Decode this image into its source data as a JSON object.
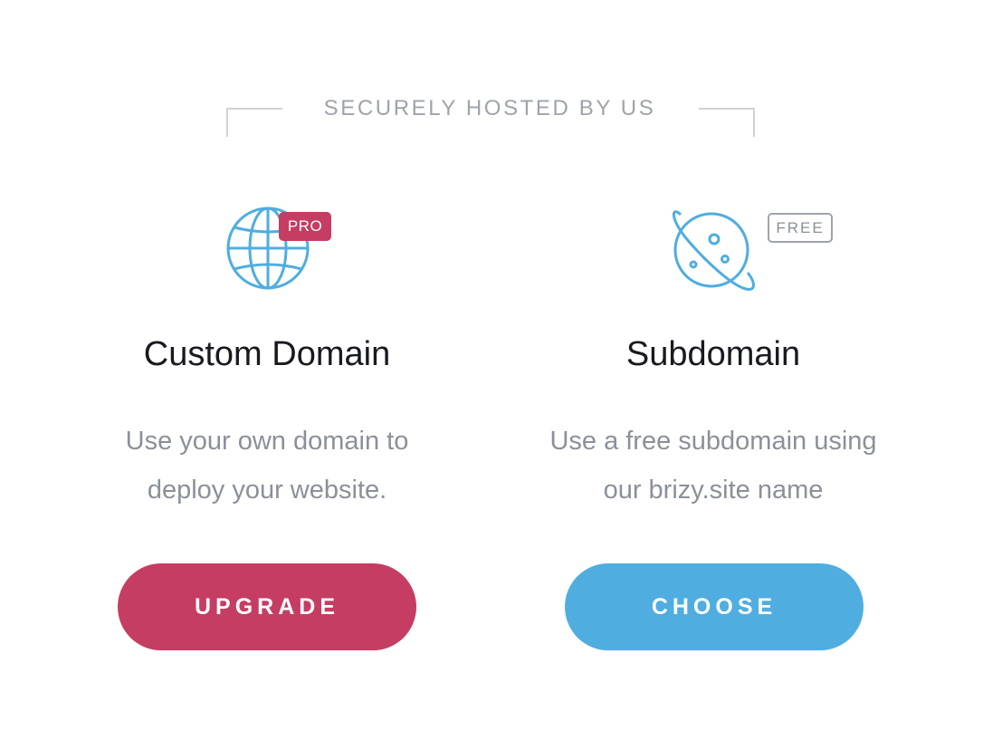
{
  "header": {
    "title": "SECURELY HOSTED BY US"
  },
  "options": {
    "custom_domain": {
      "icon": "globe-icon",
      "badge": "PRO",
      "title": "Custom Domain",
      "description_lines": [
        "Use your own domain to",
        "deploy your website."
      ],
      "button_label": "UPGRADE"
    },
    "subdomain": {
      "icon": "planet-icon",
      "badge": "FREE",
      "title": "Subdomain",
      "description_lines": [
        "Use a free subdomain using",
        "our brizy.site name"
      ],
      "button_label": "CHOOSE"
    }
  },
  "colors": {
    "pro_accent": "#c53d63",
    "free_accent": "#4fade0",
    "icon_stroke": "#4fade0",
    "muted_text": "#8b9099",
    "heading_text": "#181a20"
  }
}
